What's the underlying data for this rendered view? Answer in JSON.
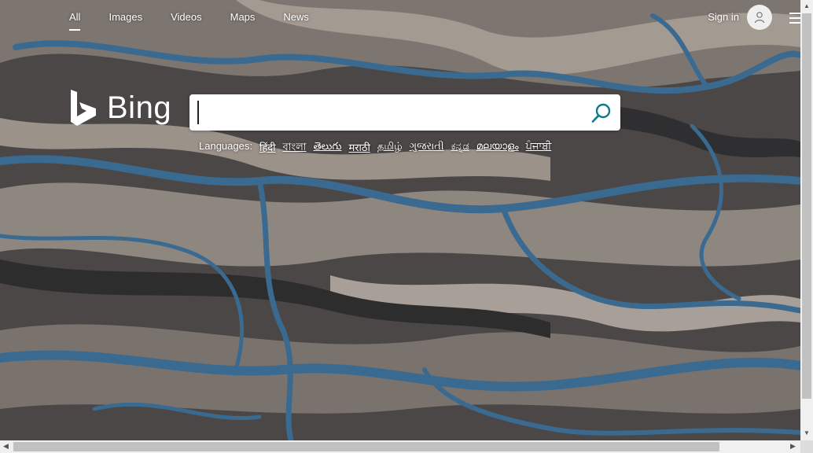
{
  "nav": {
    "items": [
      {
        "label": "All",
        "active": true
      },
      {
        "label": "Images",
        "active": false
      },
      {
        "label": "Videos",
        "active": false
      },
      {
        "label": "Maps",
        "active": false
      },
      {
        "label": "News",
        "active": false
      }
    ]
  },
  "header": {
    "signin_label": "Sign in",
    "avatar_icon": "user-icon",
    "menu_icon": "hamburger-icon"
  },
  "logo": {
    "text": "Bing"
  },
  "search": {
    "value": "",
    "placeholder": "",
    "icon": "search-icon"
  },
  "languages": {
    "label": "Languages:",
    "items": [
      "हिंदी",
      "বাংলা",
      "తెలుగు",
      "मराठी",
      "தமிழ்",
      "ગુજરાતી",
      "ಕನ್ನಡ",
      "മലയാളം",
      "ਪੰਜਾਬੀ"
    ]
  },
  "colors": {
    "accent": "#0f7a8f",
    "river": "#3b6a91",
    "sand": "#b5aaa0"
  }
}
